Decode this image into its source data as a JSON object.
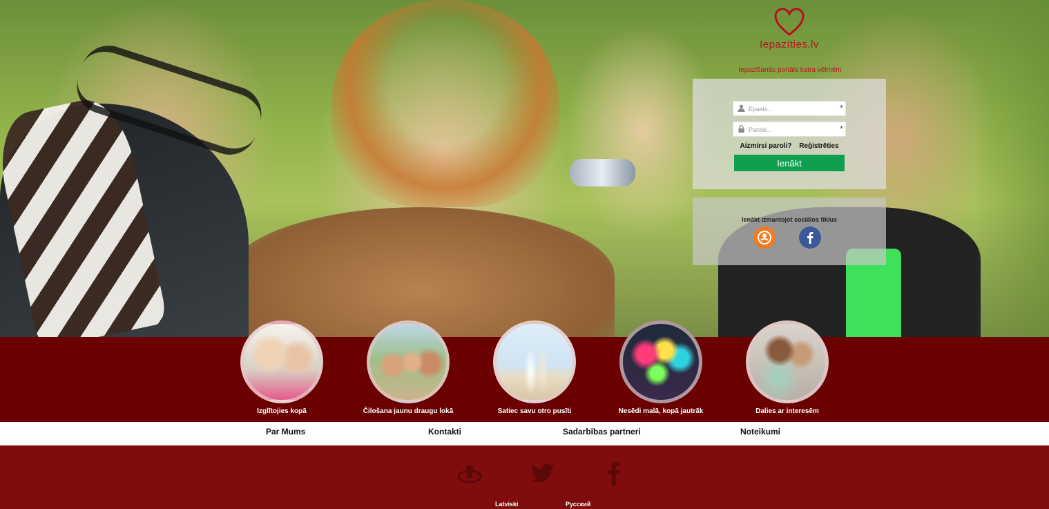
{
  "brand": {
    "name": "Iepazīties.lv",
    "tagline": "Iepazīšanās portāls katra vēlmēm"
  },
  "login": {
    "email_placeholder": "Epasts...",
    "password_placeholder": "Parole...",
    "forgot_label": "Aizmirsi paroli?",
    "register_label": "Reģistrēties",
    "submit_label": "Ienākt",
    "required_mark": "*"
  },
  "social": {
    "title": "Ienākt izmantojot sociālos tīklus",
    "icons": [
      "draugiem-icon",
      "facebook-icon"
    ]
  },
  "features": [
    {
      "label": "Izglītojies kopā"
    },
    {
      "label": "Čilošana jaunu draugu lokā"
    },
    {
      "label": "Satiec savu otro pusīti"
    },
    {
      "label": "Nesēdi malā, kopā jautrāk"
    },
    {
      "label": "Dalies ar interesēm"
    }
  ],
  "nav": {
    "about": "Par Mums",
    "contacts": "Kontakti",
    "partners": "Sadarbības partneri",
    "rules": "Noteikumi"
  },
  "footer": {
    "icons": [
      "draugiem-icon",
      "twitter-icon",
      "facebook-icon"
    ],
    "languages": [
      "Latviski",
      "Русский"
    ]
  },
  "colors": {
    "brand_red": "#b3121d",
    "features_band": "#6b0000",
    "footer": "#7f0d0d",
    "login_button": "#109f4f"
  }
}
